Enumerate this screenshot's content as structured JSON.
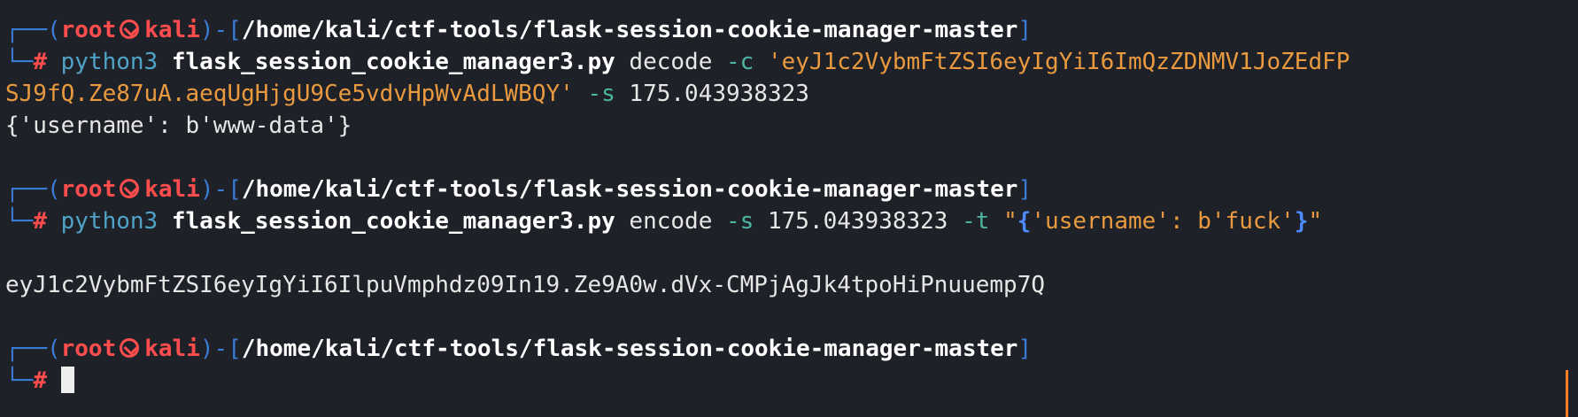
{
  "prompt": {
    "corner_top": "┌──",
    "corner_bottom": "└─",
    "open_paren": "(",
    "user": "root",
    "host": "kali",
    "close_paren": ")",
    "dash": "-",
    "open_bracket": "[",
    "path": "/home/kali/ctf-tools/flask-session-cookie-manager-master",
    "close_bracket": "]",
    "hash": "#"
  },
  "block1": {
    "cmd": "python3",
    "script": "flask_session_cookie_manager3.py",
    "action": "decode",
    "flag_c": "-c",
    "cookie_part1": "'eyJ1c2VybmFtZSI6eyIgYiI6ImQzZDNMV1JoZEdFP",
    "cookie_part2": "SJ9fQ.Ze87uA.aeqUgHjgU9Ce5vdvHpWvAdLWBQY'",
    "flag_s": "-s",
    "secret": "175.043938323",
    "output": "{'username': b'www-data'}"
  },
  "block2": {
    "cmd": "python3",
    "script": "flask_session_cookie_manager3.py",
    "action": "encode",
    "flag_s": "-s",
    "secret": "175.043938323",
    "flag_t": "-t",
    "quote_open": "\"",
    "brace_open": "{",
    "payload": "'username': b'fuck'",
    "brace_close": "}",
    "quote_close": "\"",
    "output": "eyJ1c2VybmFtZSI6eyIgYiI6IlpuVmphdz09In19.Ze9A0w.dVx-CMPjAgJk4tpoHiPnuuemp7Q"
  },
  "colors": {
    "background": "#1f2129",
    "prompt_frame": "#3a7bd5",
    "prompt_user": "#ff4d4d",
    "command": "#4fa3c7",
    "string": "#e99a3f",
    "flag": "#4cb6a3"
  },
  "icons": {
    "skull_separator": "kali-skull-icon"
  }
}
